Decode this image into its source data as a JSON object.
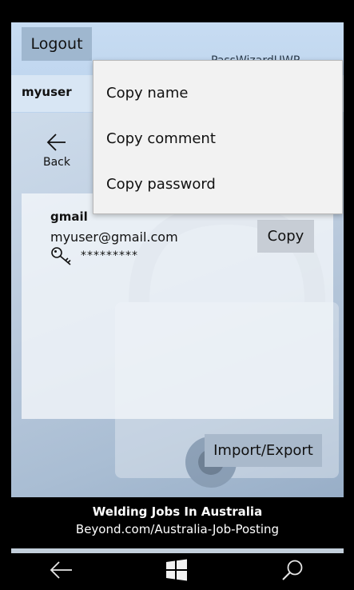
{
  "header": {
    "logout_label": "Logout",
    "obscured_title": "PassWizardUWP",
    "username": "myuser"
  },
  "nav": {
    "back_label": "Back"
  },
  "entry": {
    "name": "gmail",
    "comment": "myuser@gmail.com",
    "password_masked": "*********",
    "copy_label": "Copy"
  },
  "context_menu": {
    "items": [
      {
        "label": "Copy name"
      },
      {
        "label": "Copy comment"
      },
      {
        "label": "Copy password"
      }
    ]
  },
  "footer": {
    "import_export_label": "Import/Export"
  },
  "ad": {
    "title": "Welding Jobs In Australia",
    "url": "Beyond.com/Australia-Job-Posting"
  },
  "system_nav": {
    "icons": [
      "back-arrow-icon",
      "windows-start-icon",
      "search-icon"
    ]
  },
  "colors": {
    "header_band": "#c7dcf2",
    "logout_button": "#9fb7cf",
    "menu_background": "#f2f2f2",
    "import_button": "#a9b9cb"
  }
}
